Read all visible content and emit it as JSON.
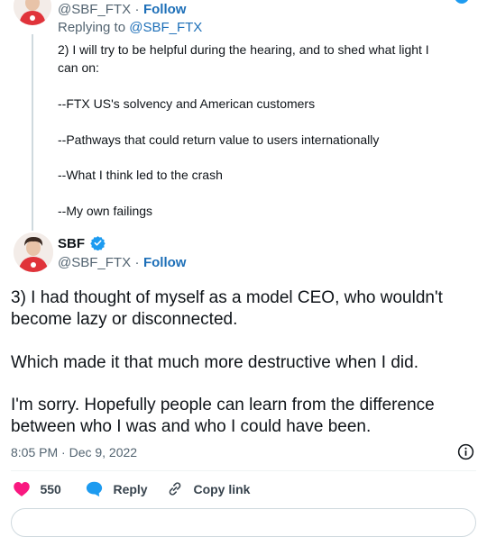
{
  "parent_tweet": {
    "handle": "@SBF_FTX",
    "separator": "·",
    "follow_label": "Follow",
    "replying_to_prefix": "Replying to ",
    "replying_to_handle": "@SBF_FTX",
    "lines": [
      "2) I will try to be helpful during the hearing, and to shed what light I",
      "can on:",
      "--FTX US's solvency and American customers",
      "--Pathways that could return value to users internationally",
      "--What I think led to the crash",
      "--My own failings"
    ]
  },
  "main_tweet": {
    "display_name": "SBF",
    "handle": "@SBF_FTX",
    "separator": "·",
    "follow_label": "Follow",
    "text_lines": [
      "3) I had thought of myself as a model CEO, who wouldn't",
      "become lazy or disconnected.",
      "Which made it that much more destructive when I did.",
      "I'm sorry.  Hopefully people can learn from the difference",
      "between who I was and who I could have been."
    ],
    "timestamp": "8:05 PM · Dec 9, 2022"
  },
  "actions": {
    "like_count": "550",
    "reply_label": "Reply",
    "copy_link_label": "Copy link"
  },
  "colors": {
    "link_blue": "#1d6fb8",
    "verified_blue": "#1d9bf0",
    "like_pink": "#f91880",
    "muted": "#536471"
  },
  "icons": [
    "verified-badge-icon",
    "info-icon",
    "heart-icon",
    "reply-bubble-icon",
    "link-icon"
  ]
}
